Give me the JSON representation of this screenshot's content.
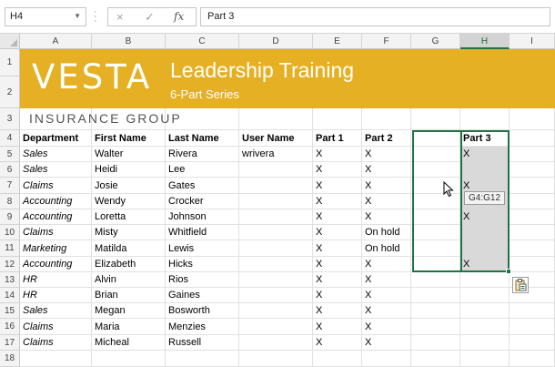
{
  "formula_bar": {
    "name_box": "H4",
    "cancel_icon": "×",
    "enter_icon": "✓",
    "function_icon": "fx",
    "content": "Part 3"
  },
  "columns": [
    "A",
    "B",
    "C",
    "D",
    "E",
    "F",
    "G",
    "H",
    "I"
  ],
  "active_column": "H",
  "rows": [
    "1",
    "2",
    "3",
    "4",
    "5",
    "6",
    "7",
    "8",
    "9",
    "10",
    "11",
    "12",
    "13",
    "14",
    "15",
    "16",
    "17",
    "18"
  ],
  "banner": {
    "logo": "VESTA",
    "title": "Leadership Training",
    "subtitle": "6-Part Series",
    "company": "INSURANCE  GROUP"
  },
  "headers": [
    "Department",
    "First Name",
    "Last Name",
    "User Name",
    "Part 1",
    "Part 2",
    "",
    "Part 3"
  ],
  "table": [
    [
      "Sales",
      "Walter",
      "Rivera",
      "wrivera",
      "X",
      "X",
      "",
      "X"
    ],
    [
      "Sales",
      "Heidi",
      "Lee",
      "",
      "X",
      "X",
      "",
      ""
    ],
    [
      "Claims",
      "Josie",
      "Gates",
      "",
      "X",
      "X",
      "",
      "X"
    ],
    [
      "Accounting",
      "Wendy",
      "Crocker",
      "",
      "X",
      "X",
      "",
      ""
    ],
    [
      "Accounting",
      "Loretta",
      "Johnson",
      "",
      "X",
      "X",
      "",
      "X"
    ],
    [
      "Claims",
      "Misty",
      "Whitfield",
      "",
      "X",
      "On hold",
      "",
      ""
    ],
    [
      "Marketing",
      "Matilda",
      "Lewis",
      "",
      "X",
      "On hold",
      "",
      ""
    ],
    [
      "Accounting",
      "Elizabeth",
      "Hicks",
      "",
      "X",
      "X",
      "",
      "X"
    ],
    [
      "HR",
      "Alvin",
      "Rios",
      "",
      "X",
      "X",
      "",
      ""
    ],
    [
      "HR",
      "Brian",
      "Gaines",
      "",
      "X",
      "X",
      "",
      ""
    ],
    [
      "Sales",
      "Megan",
      "Bosworth",
      "",
      "X",
      "X",
      "",
      ""
    ],
    [
      "Claims",
      "Maria",
      "Menzies",
      "",
      "X",
      "X",
      "",
      ""
    ],
    [
      "Claims",
      "Micheal",
      "Russell",
      "",
      "X",
      "X",
      "",
      ""
    ]
  ],
  "drag_tooltip": "G4:G12",
  "icons": {
    "cursor": "arrow-pointer-icon",
    "paste_options": "paste-options-icon",
    "name_box_dropdown": "chevron-down-icon"
  },
  "colors": {
    "banner": "#e5b023",
    "selection": "#217346",
    "selected_fill": "#d9d9d9"
  }
}
